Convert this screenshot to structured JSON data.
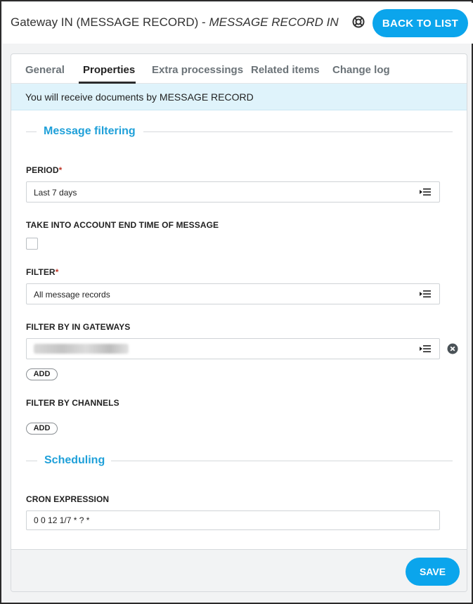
{
  "header": {
    "title_plain": "Gateway IN (MESSAGE RECORD) - ",
    "title_italic": "MESSAGE RECORD IN",
    "back_label": "BACK TO LIST",
    "help_icon": "lifebuoy-icon"
  },
  "tabs": [
    {
      "label": "General",
      "active": false
    },
    {
      "label": "Properties",
      "active": true
    },
    {
      "label": "Extra processings",
      "active": false
    },
    {
      "label": "Related items",
      "active": false
    },
    {
      "label": "Change log",
      "active": false
    }
  ],
  "notice": "You will receive documents by MESSAGE RECORD",
  "sections": {
    "filtering": "Message filtering",
    "scheduling": "Scheduling"
  },
  "fields": {
    "period": {
      "label": "PERIOD",
      "required": "*",
      "value": "Last 7 days"
    },
    "end_time": {
      "label": "TAKE INTO ACCOUNT END TIME OF MESSAGE",
      "checked": false
    },
    "filter": {
      "label": "FILTER",
      "required": "*",
      "value": "All message records"
    },
    "in_gateways": {
      "label": "FILTER BY IN GATEWAYS",
      "add_label": "ADD"
    },
    "channels": {
      "label": "FILTER BY CHANNELS",
      "add_label": "ADD"
    },
    "cron": {
      "label": "CRON EXPRESSION",
      "value": "0 0 12 1/7 * ? *"
    }
  },
  "footer": {
    "save_label": "SAVE"
  },
  "colors": {
    "accent": "#0ba5ec",
    "section_title": "#1fa0d9",
    "notice_bg": "#dff3fb"
  }
}
